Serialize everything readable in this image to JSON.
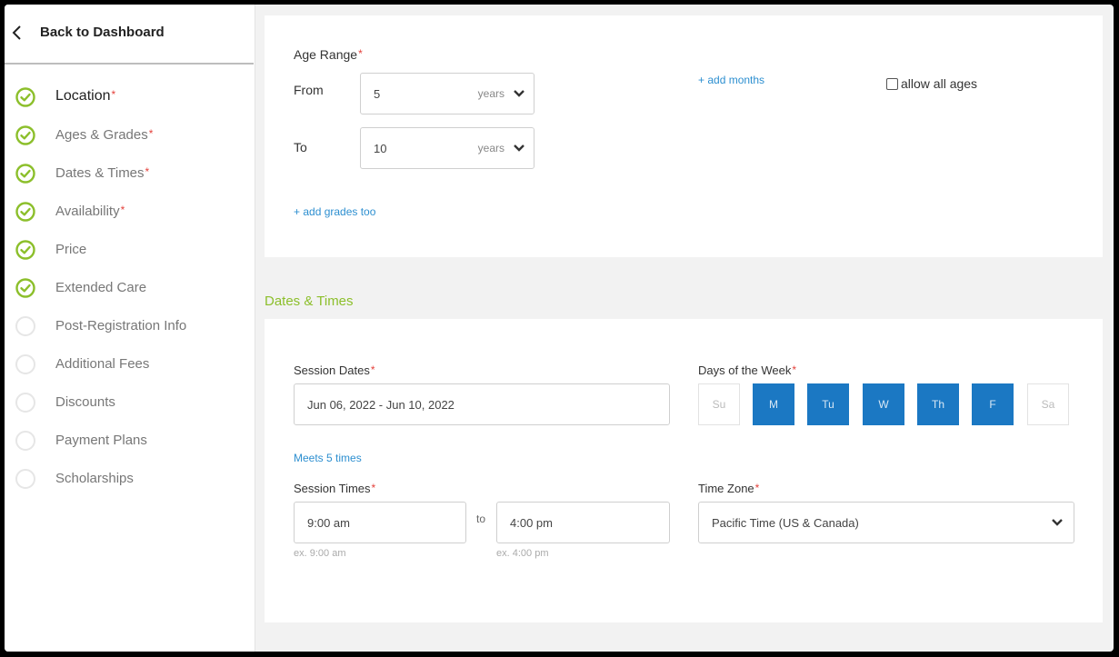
{
  "sidebar": {
    "back_label": "Back to Dashboard",
    "items": [
      {
        "label": "Location",
        "required": "*",
        "done": true,
        "active": true
      },
      {
        "label": "Ages & Grades",
        "required": "*",
        "done": true
      },
      {
        "label": "Dates & Times",
        "required": "*",
        "done": true
      },
      {
        "label": "Availability",
        "required": "*",
        "done": true
      },
      {
        "label": "Price",
        "required": "",
        "done": true
      },
      {
        "label": "Extended Care",
        "required": "",
        "done": true
      },
      {
        "label": "Post-Registration Info",
        "required": "",
        "done": false
      },
      {
        "label": "Additional Fees",
        "required": "",
        "done": false
      },
      {
        "label": "Discounts",
        "required": "",
        "done": false
      },
      {
        "label": "Payment Plans",
        "required": "",
        "done": false
      },
      {
        "label": "Scholarships",
        "required": "",
        "done": false
      }
    ]
  },
  "ages": {
    "age_range_label": "Age Range",
    "required": "*",
    "from_label": "From",
    "to_label": "To",
    "from_value": "5",
    "to_value": "10",
    "unit": "years",
    "add_months": "+ add months",
    "allow_all_ages": "allow all ages",
    "add_grades": "+ add grades too"
  },
  "dates": {
    "section_title": "Dates & Times",
    "session_dates_label": "Session Dates",
    "session_dates_value": "Jun 06, 2022 - Jun 10, 2022",
    "meets_text": "Meets 5 times",
    "days_label": "Days of the Week",
    "days": [
      {
        "label": "Su",
        "on": false
      },
      {
        "label": "M",
        "on": true
      },
      {
        "label": "Tu",
        "on": true
      },
      {
        "label": "W",
        "on": true
      },
      {
        "label": "Th",
        "on": true
      },
      {
        "label": "F",
        "on": true
      },
      {
        "label": "Sa",
        "on": false
      }
    ],
    "session_times_label": "Session Times",
    "start_time": "9:00 am",
    "to_text": "to",
    "end_time": "4:00 pm",
    "start_hint": "ex. 9:00 am",
    "end_hint": "ex. 4:00 pm",
    "timezone_label": "Time Zone",
    "timezone_value": "Pacific Time (US & Canada)"
  },
  "colors": {
    "accent_green": "#8cbf2b",
    "day_active_blue": "#1b78c3",
    "link_blue": "#2d8fd0",
    "required_red": "#e4413b"
  }
}
